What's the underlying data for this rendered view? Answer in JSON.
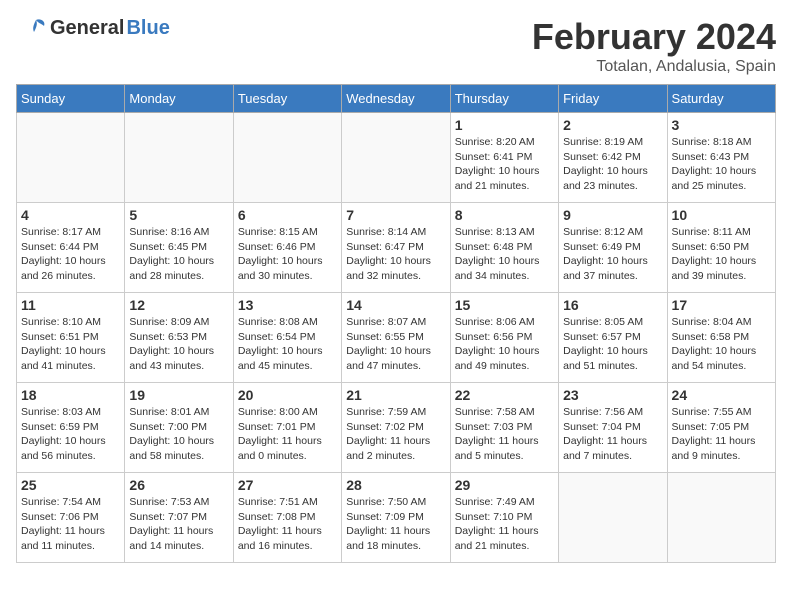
{
  "header": {
    "logo_general": "General",
    "logo_blue": "Blue",
    "month_title": "February 2024",
    "location": "Totalan, Andalusia, Spain"
  },
  "calendar": {
    "days_of_week": [
      "Sunday",
      "Monday",
      "Tuesday",
      "Wednesday",
      "Thursday",
      "Friday",
      "Saturday"
    ],
    "weeks": [
      {
        "days": [
          {
            "num": "",
            "info": ""
          },
          {
            "num": "",
            "info": ""
          },
          {
            "num": "",
            "info": ""
          },
          {
            "num": "",
            "info": ""
          },
          {
            "num": "1",
            "info": "Sunrise: 8:20 AM\nSunset: 6:41 PM\nDaylight: 10 hours\nand 21 minutes."
          },
          {
            "num": "2",
            "info": "Sunrise: 8:19 AM\nSunset: 6:42 PM\nDaylight: 10 hours\nand 23 minutes."
          },
          {
            "num": "3",
            "info": "Sunrise: 8:18 AM\nSunset: 6:43 PM\nDaylight: 10 hours\nand 25 minutes."
          }
        ]
      },
      {
        "days": [
          {
            "num": "4",
            "info": "Sunrise: 8:17 AM\nSunset: 6:44 PM\nDaylight: 10 hours\nand 26 minutes."
          },
          {
            "num": "5",
            "info": "Sunrise: 8:16 AM\nSunset: 6:45 PM\nDaylight: 10 hours\nand 28 minutes."
          },
          {
            "num": "6",
            "info": "Sunrise: 8:15 AM\nSunset: 6:46 PM\nDaylight: 10 hours\nand 30 minutes."
          },
          {
            "num": "7",
            "info": "Sunrise: 8:14 AM\nSunset: 6:47 PM\nDaylight: 10 hours\nand 32 minutes."
          },
          {
            "num": "8",
            "info": "Sunrise: 8:13 AM\nSunset: 6:48 PM\nDaylight: 10 hours\nand 34 minutes."
          },
          {
            "num": "9",
            "info": "Sunrise: 8:12 AM\nSunset: 6:49 PM\nDaylight: 10 hours\nand 37 minutes."
          },
          {
            "num": "10",
            "info": "Sunrise: 8:11 AM\nSunset: 6:50 PM\nDaylight: 10 hours\nand 39 minutes."
          }
        ]
      },
      {
        "days": [
          {
            "num": "11",
            "info": "Sunrise: 8:10 AM\nSunset: 6:51 PM\nDaylight: 10 hours\nand 41 minutes."
          },
          {
            "num": "12",
            "info": "Sunrise: 8:09 AM\nSunset: 6:53 PM\nDaylight: 10 hours\nand 43 minutes."
          },
          {
            "num": "13",
            "info": "Sunrise: 8:08 AM\nSunset: 6:54 PM\nDaylight: 10 hours\nand 45 minutes."
          },
          {
            "num": "14",
            "info": "Sunrise: 8:07 AM\nSunset: 6:55 PM\nDaylight: 10 hours\nand 47 minutes."
          },
          {
            "num": "15",
            "info": "Sunrise: 8:06 AM\nSunset: 6:56 PM\nDaylight: 10 hours\nand 49 minutes."
          },
          {
            "num": "16",
            "info": "Sunrise: 8:05 AM\nSunset: 6:57 PM\nDaylight: 10 hours\nand 51 minutes."
          },
          {
            "num": "17",
            "info": "Sunrise: 8:04 AM\nSunset: 6:58 PM\nDaylight: 10 hours\nand 54 minutes."
          }
        ]
      },
      {
        "days": [
          {
            "num": "18",
            "info": "Sunrise: 8:03 AM\nSunset: 6:59 PM\nDaylight: 10 hours\nand 56 minutes."
          },
          {
            "num": "19",
            "info": "Sunrise: 8:01 AM\nSunset: 7:00 PM\nDaylight: 10 hours\nand 58 minutes."
          },
          {
            "num": "20",
            "info": "Sunrise: 8:00 AM\nSunset: 7:01 PM\nDaylight: 11 hours\nand 0 minutes."
          },
          {
            "num": "21",
            "info": "Sunrise: 7:59 AM\nSunset: 7:02 PM\nDaylight: 11 hours\nand 2 minutes."
          },
          {
            "num": "22",
            "info": "Sunrise: 7:58 AM\nSunset: 7:03 PM\nDaylight: 11 hours\nand 5 minutes."
          },
          {
            "num": "23",
            "info": "Sunrise: 7:56 AM\nSunset: 7:04 PM\nDaylight: 11 hours\nand 7 minutes."
          },
          {
            "num": "24",
            "info": "Sunrise: 7:55 AM\nSunset: 7:05 PM\nDaylight: 11 hours\nand 9 minutes."
          }
        ]
      },
      {
        "days": [
          {
            "num": "25",
            "info": "Sunrise: 7:54 AM\nSunset: 7:06 PM\nDaylight: 11 hours\nand 11 minutes."
          },
          {
            "num": "26",
            "info": "Sunrise: 7:53 AM\nSunset: 7:07 PM\nDaylight: 11 hours\nand 14 minutes."
          },
          {
            "num": "27",
            "info": "Sunrise: 7:51 AM\nSunset: 7:08 PM\nDaylight: 11 hours\nand 16 minutes."
          },
          {
            "num": "28",
            "info": "Sunrise: 7:50 AM\nSunset: 7:09 PM\nDaylight: 11 hours\nand 18 minutes."
          },
          {
            "num": "29",
            "info": "Sunrise: 7:49 AM\nSunset: 7:10 PM\nDaylight: 11 hours\nand 21 minutes."
          },
          {
            "num": "",
            "info": ""
          },
          {
            "num": "",
            "info": ""
          }
        ]
      }
    ]
  }
}
